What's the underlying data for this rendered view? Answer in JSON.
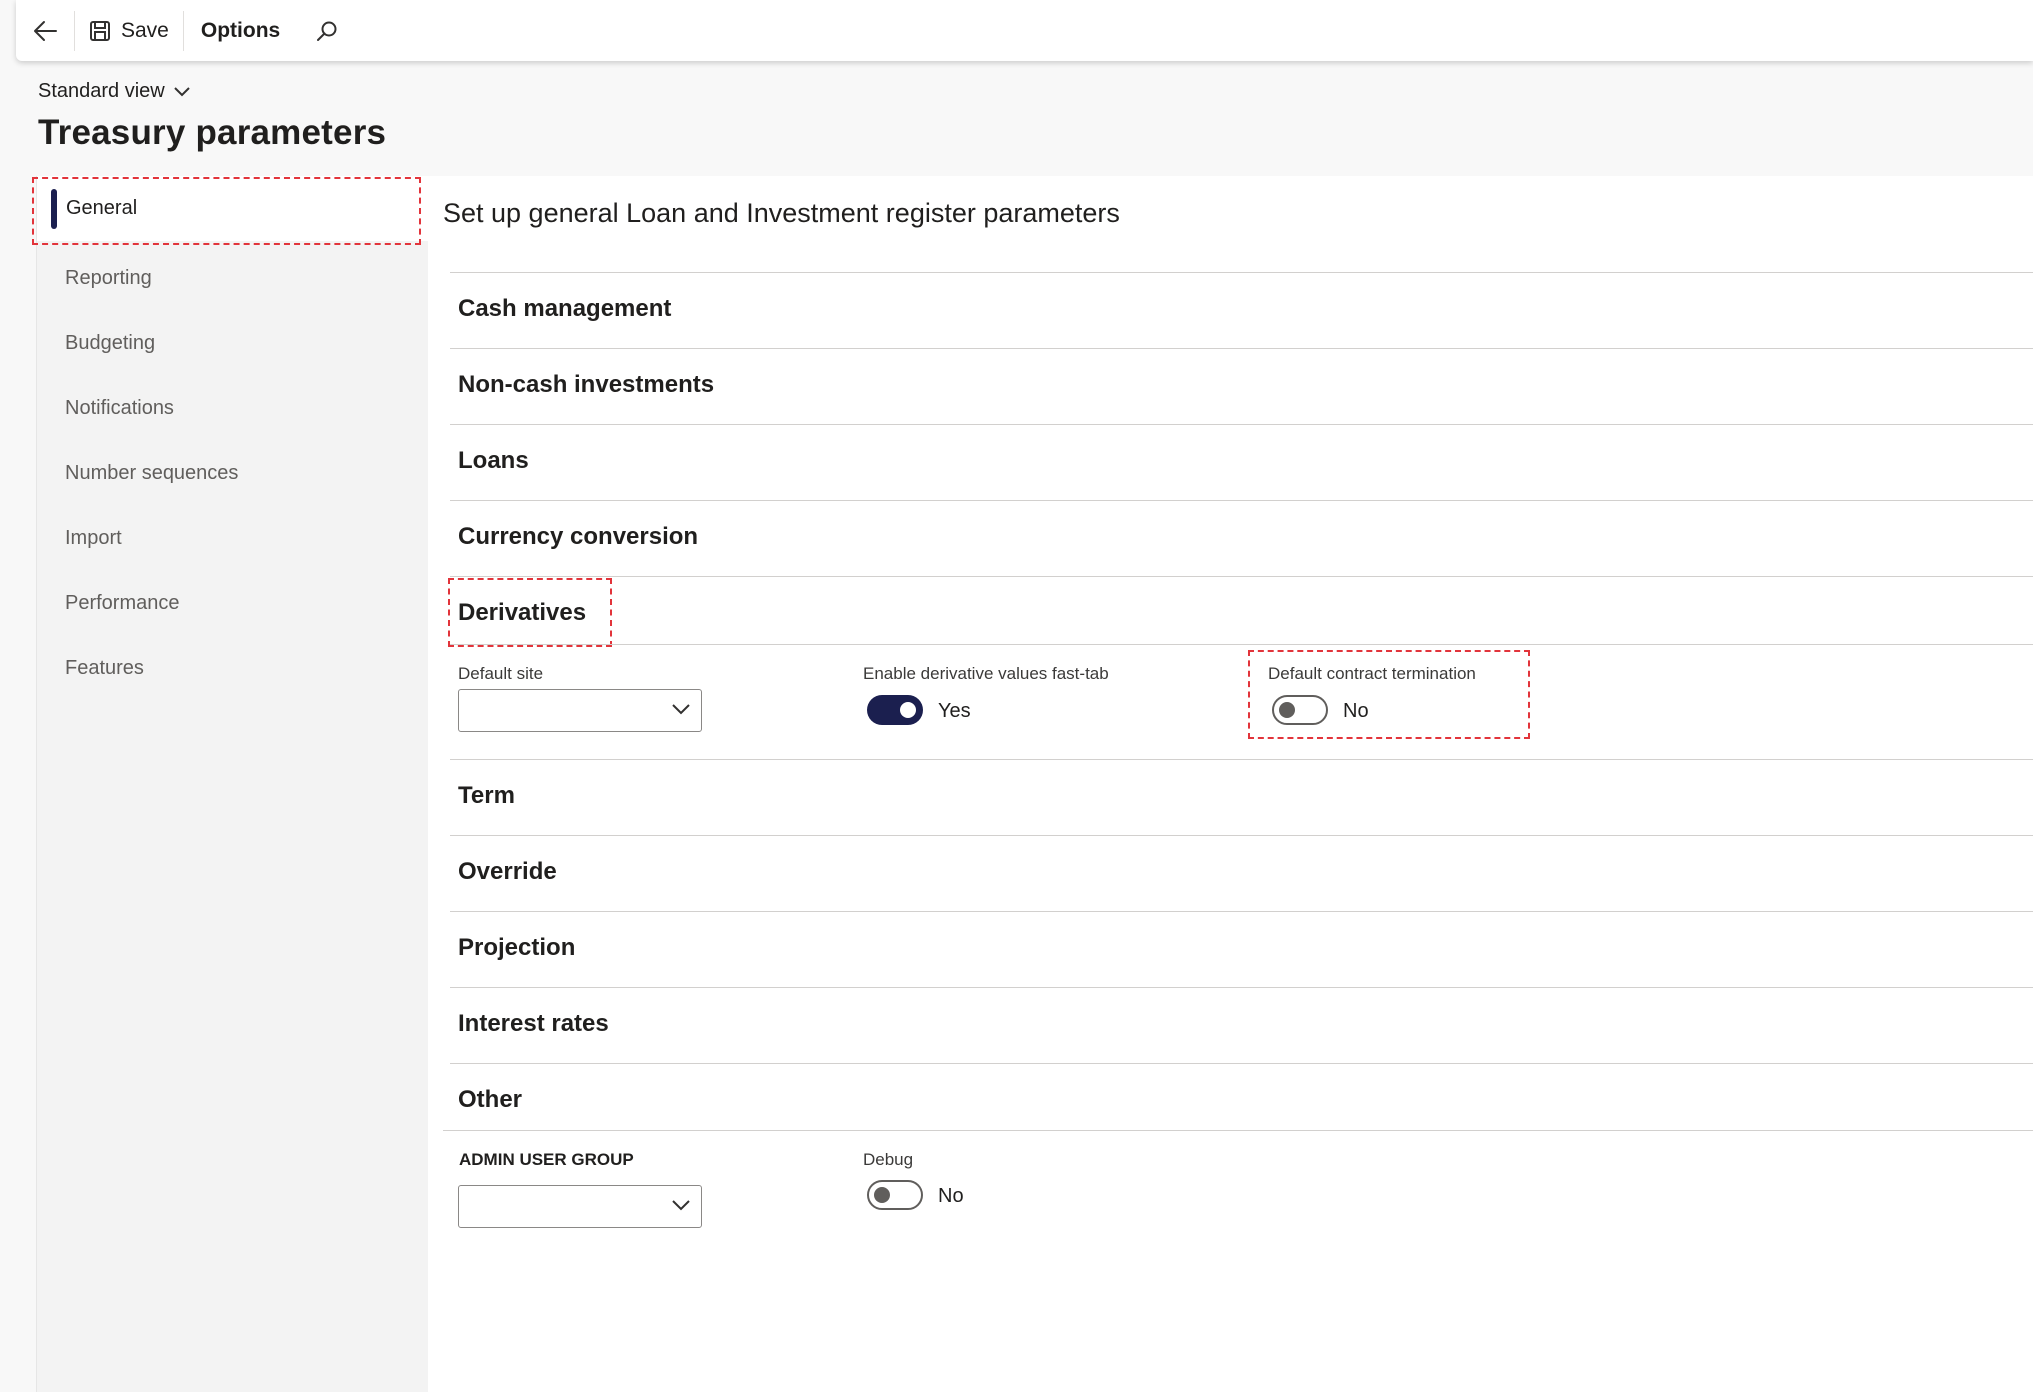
{
  "toolbar": {
    "save_label": "Save",
    "options_label": "Options"
  },
  "view": {
    "label": "Standard view"
  },
  "page": {
    "title": "Treasury parameters"
  },
  "nav": {
    "items": [
      {
        "label": "General"
      },
      {
        "label": "Reporting"
      },
      {
        "label": "Budgeting"
      },
      {
        "label": "Notifications"
      },
      {
        "label": "Number sequences"
      },
      {
        "label": "Import"
      },
      {
        "label": "Performance"
      },
      {
        "label": "Features"
      }
    ]
  },
  "main": {
    "title": "Set up general Loan and Investment register parameters",
    "tabs": [
      {
        "label": "Cash management"
      },
      {
        "label": "Non-cash investments"
      },
      {
        "label": "Loans"
      },
      {
        "label": "Currency conversion"
      },
      {
        "label": "Derivatives"
      },
      {
        "label": "Term"
      },
      {
        "label": "Override"
      },
      {
        "label": "Projection"
      },
      {
        "label": "Interest rates"
      },
      {
        "label": "Other"
      }
    ],
    "derivatives": {
      "default_site_label": "Default site",
      "default_site_value": "",
      "enable_fasttab_label": "Enable derivative values fast-tab",
      "enable_fasttab_value": "Yes",
      "default_termination_label": "Default contract termination",
      "default_termination_value": "No"
    },
    "other": {
      "admin_group_label": "ADMIN USER GROUP",
      "admin_group_value": "",
      "debug_label": "Debug",
      "debug_value": "No"
    }
  },
  "colors": {
    "accent": "#1b1f4f",
    "highlight": "#e2343b"
  }
}
